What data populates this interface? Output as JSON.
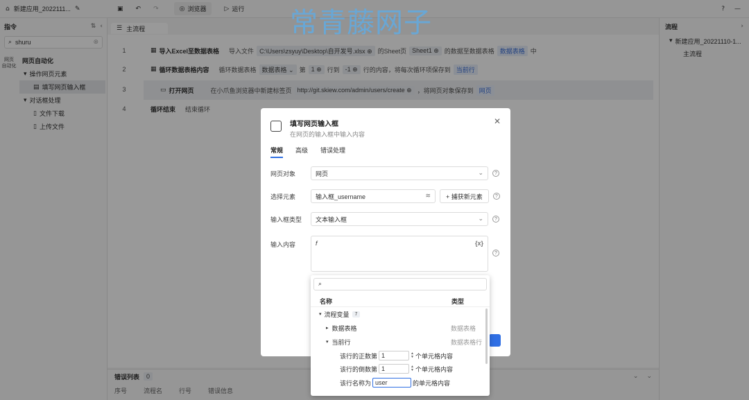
{
  "topbar": {
    "app_name": "新建应用_2022111...",
    "preview_label": "浏览器",
    "run_label": "运行"
  },
  "sidebar": {
    "title": "指令",
    "search_value": "shuru",
    "vtab": "网页\n自动化",
    "tree": [
      {
        "label": "网页自动化",
        "level": 0
      },
      {
        "label": "操作网页元素",
        "level": 1
      },
      {
        "label": "填写网页输入框",
        "level": 2,
        "selected": true
      },
      {
        "label": "对话框处理",
        "level": 1
      },
      {
        "label": "文件下载",
        "level": 2
      },
      {
        "label": "上传文件",
        "level": 2
      }
    ]
  },
  "main": {
    "tab_label": "主流程",
    "steps": [
      {
        "num": "1",
        "title": "导入Excel至数据表格",
        "d1": "导入文件",
        "p1": "C:\\Users\\zsyuy\\Desktop\\自开发号.xlsx ⊕",
        "d2": "的Sheet页",
        "p2": "Sheet1 ⊕",
        "d3": "的数据至数据表格",
        "p3": "数据表格",
        "d4": "中"
      },
      {
        "num": "2",
        "title": "循环数据表格内容",
        "d1": "循环数据表格",
        "p1": "数据表格 ⌄",
        "d2": "第",
        "p2": "1 ⊕",
        "d3": "行到",
        "p3": "-1 ⊕",
        "d4": "行的内容，将每次循环项保存到",
        "p4": "当前行"
      },
      {
        "num": "3",
        "title": "打开网页",
        "d1": "在小爪鱼浏览器中新建标签页",
        "p1": "http://git.skiew.com/admin/users/create ⊕",
        "d2": "，将网页对象保存到",
        "p2": "网页"
      },
      {
        "num": "4",
        "title": "循环结束",
        "d1": "结束循环"
      }
    ],
    "bottom_title": "错误列表",
    "bottom_count": "0",
    "bottom_cols": [
      "序号",
      "流程名",
      "行号",
      "错误信息"
    ]
  },
  "rpanel": {
    "title": "流程",
    "root": "新建应用_20221110-1...",
    "child": "主流程"
  },
  "watermark": "常青藤网子",
  "modal": {
    "title": "填写网页输入框",
    "subtitle": "在网页的输入框中输入内容",
    "tabs": [
      "常规",
      "高级",
      "错误处理"
    ],
    "page_label": "网页对象",
    "page_value": "网页",
    "element_label": "选择元素",
    "element_value": "输入框_username",
    "capture_label": "+ 捕获新元素",
    "type_label": "输入框类型",
    "type_value": "文本输入框",
    "content_label": "输入内容",
    "content_fx": "f",
    "content_var": "{x}"
  },
  "popup": {
    "search_placeholder": "",
    "col_name": "名称",
    "col_type": "类型",
    "group": "流程变量",
    "group_badge": "7",
    "var1": "数据表格",
    "var1_type": "数据表格",
    "var2": "当前行",
    "var2_type": "数据表格行",
    "row_pos_pre": "该行的正数第",
    "row_pos_val": "1",
    "row_pos_post": "个单元格内容",
    "row_neg_pre": "该行的倒数第",
    "row_neg_val": "1",
    "row_neg_post": "个单元格内容",
    "row_name_pre": "该行名称为",
    "row_name_val": "user",
    "row_name_post": "的单元格内容"
  }
}
